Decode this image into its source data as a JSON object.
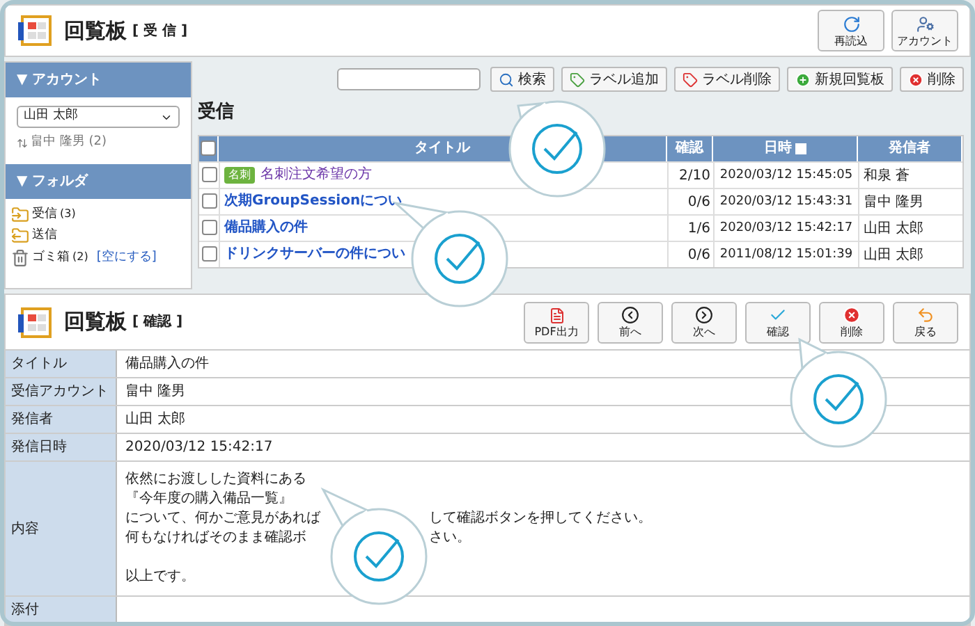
{
  "header": {
    "title": "回覧板",
    "subtitle": "[ 受 信 ]",
    "buttons": [
      "再読込",
      "アカウント"
    ]
  },
  "sidebar": {
    "account_heading": "▼ アカウント",
    "account_select": "山田 太郎",
    "account_sub": "畠中 隆男 (2)",
    "folder_heading": "▼ フォルダ",
    "folders": [
      {
        "name": "受信",
        "count": "(3)"
      },
      {
        "name": "送信"
      },
      {
        "name": "ゴミ箱",
        "count": "(2)",
        "link": "[空にする]"
      }
    ]
  },
  "toolbar": {
    "buttons": [
      "検索",
      "ラベル追加",
      "ラベル削除",
      "新規回覧板",
      "削除"
    ]
  },
  "list": {
    "heading": "受信",
    "all_checked": false,
    "columns": [
      "タイトル",
      "確認",
      "日時",
      "発信者"
    ],
    "rows": [
      {
        "checked": false,
        "unread": false,
        "tag": "名刺",
        "title": "名刺注文希望の方",
        "confirm": "2/10",
        "date": "2020/03/12 15:45:05",
        "sender": "和泉 蒼"
      },
      {
        "checked": false,
        "unread": true,
        "title": "次期GroupSessionについ",
        "confirm": "0/6",
        "date": "2020/03/12 15:43:31",
        "sender": "畠中 隆男"
      },
      {
        "checked": false,
        "unread": true,
        "title": "備品購入の件",
        "confirm": "1/6",
        "date": "2020/03/12 15:42:17",
        "sender": "山田 太郎"
      },
      {
        "checked": false,
        "unread": true,
        "title": "ドリンクサーバーの件につい",
        "confirm": "0/6",
        "date": "2011/08/12 15:01:39",
        "sender": "山田 太郎"
      }
    ]
  },
  "detail": {
    "title": "回覧板",
    "subtitle": "[ 確認 ]",
    "buttons": [
      "PDF出力",
      "前へ",
      "次へ",
      "確認",
      "削除",
      "戻る"
    ],
    "fields": [
      {
        "label": "タイトル",
        "lines": [
          {
            "parts": [
              "備品購入の件"
            ]
          }
        ]
      },
      {
        "label": "受信アカウント",
        "lines": [
          {
            "parts": [
              "畠中 隆男"
            ]
          }
        ]
      },
      {
        "label": "発信者",
        "lines": [
          {
            "parts": [
              "山田 太郎"
            ]
          }
        ]
      },
      {
        "label": "発信日時",
        "lines": [
          {
            "parts": [
              "2020/03/12 15:42:17"
            ]
          }
        ]
      },
      {
        "label": "内容",
        "lines": [
          {
            "parts": [
              "依然にお渡しした資料にある"
            ]
          },
          {
            "parts": [
              "『今年度の購入備品一覧』"
            ]
          },
          {
            "parts": [
              "について、何かご意見があれば",
              "して確認ボタンを押してください。"
            ]
          },
          {
            "parts": [
              "何もなければそのまま確認ボ",
              "さい。"
            ]
          },
          {
            "parts": [
              "以上です。"
            ],
            "spaced": true
          }
        ]
      },
      {
        "label": "添付"
      }
    ]
  }
}
